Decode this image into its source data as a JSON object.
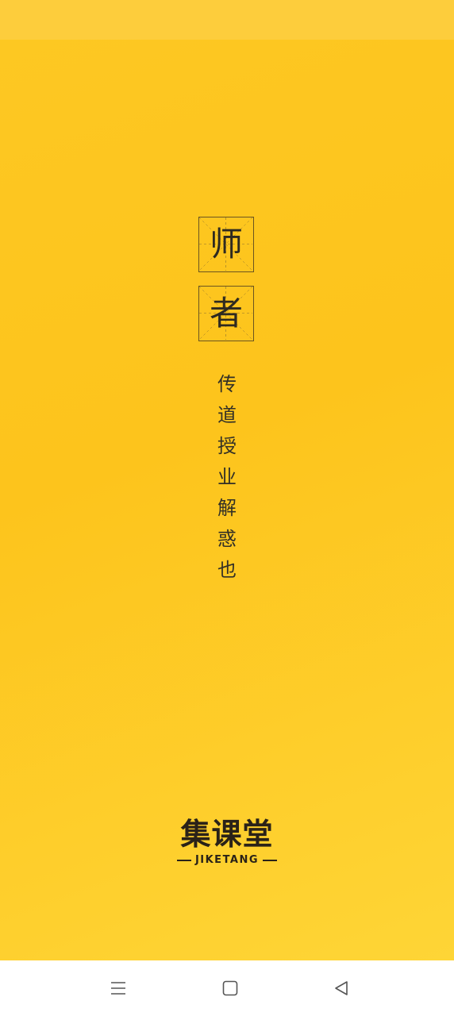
{
  "theme": {
    "background": "#fdc823",
    "text": "#2e2a20",
    "grid_border": "#6a5420"
  },
  "heading": {
    "char1": "师",
    "char2": "者"
  },
  "motto": [
    "传",
    "道",
    "授",
    "业",
    "解",
    "惑",
    "也"
  ],
  "brand": {
    "name_cn": "集课堂",
    "name_en": "JIKETANG"
  },
  "nav": {
    "menu_icon": "menu-icon",
    "home_icon": "home-icon",
    "back_icon": "back-icon"
  }
}
